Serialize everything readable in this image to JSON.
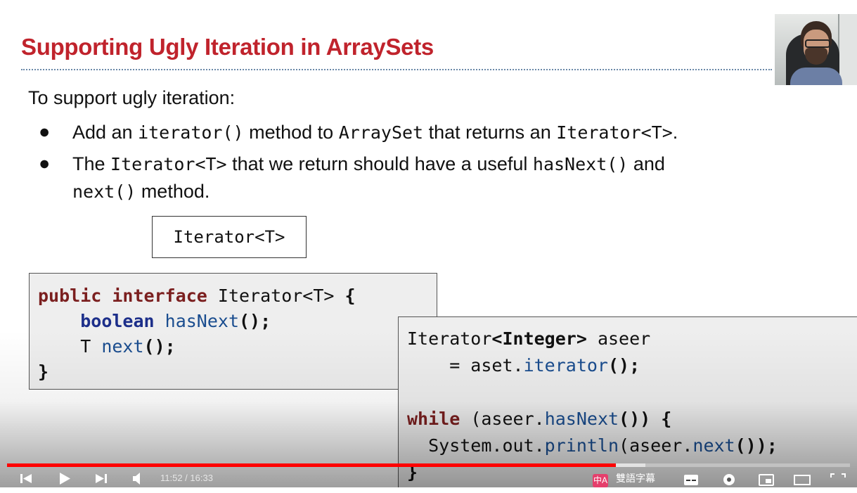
{
  "slide": {
    "title": "Supporting Ugly Iteration in ArraySets",
    "intro": "To support ugly iteration:",
    "bullet_symbol": "●",
    "bullet1": {
      "t1": "Add an ",
      "c1": "iterator()",
      "t2": " method to ",
      "c2": "ArraySet",
      "t3": " that returns an ",
      "c3": "Iterator<T>",
      "t4": "."
    },
    "bullet2": {
      "t1": "The ",
      "c1": "Iterator<T>",
      "t2": " that we return should have a useful ",
      "c2": "hasNext()",
      "t3": " and",
      "c3": "next()",
      "t4": " method."
    },
    "iterator_box": "Iterator<T>",
    "code_interface": {
      "kw_public": "public",
      "kw_interface": "interface",
      "type": " Iterator<T> ",
      "brace_open": "{",
      "kw_boolean": "boolean",
      "hasnext": "hasNext",
      "hasnext_parens": "();",
      "t_type": "T ",
      "next": "next",
      "next_parens": "();",
      "brace_close": "}"
    },
    "code_usage": {
      "decl_type": "Iterator",
      "decl_generic": "<Integer>",
      "decl_var": " aseer",
      "assign": "    = aset.",
      "iterator_fn": "iterator",
      "assign_end": "();",
      "kw_while": "while",
      "cond_start": " (aseer.",
      "hasnext_fn": "hasNext",
      "cond_end": "()) {",
      "print_start": "  System.out.",
      "println_fn": "println",
      "print_mid": "(aseer.",
      "next_fn": "next",
      "print_end": "());",
      "brace_close": "}"
    }
  },
  "player": {
    "played_fraction": 0.722,
    "buffered_fraction": 0.757,
    "time_display": "11:52 / 16:33",
    "subtitle_badge": "中A",
    "subtitle_label": "雙語字幕",
    "accent_color": "#ff0000",
    "icons": [
      "skip-previous-icon",
      "play-icon",
      "skip-next-icon",
      "volume-icon",
      "subtitles-icon",
      "settings-gear-icon",
      "miniplayer-icon",
      "theater-mode-icon",
      "fullscreen-icon"
    ]
  }
}
